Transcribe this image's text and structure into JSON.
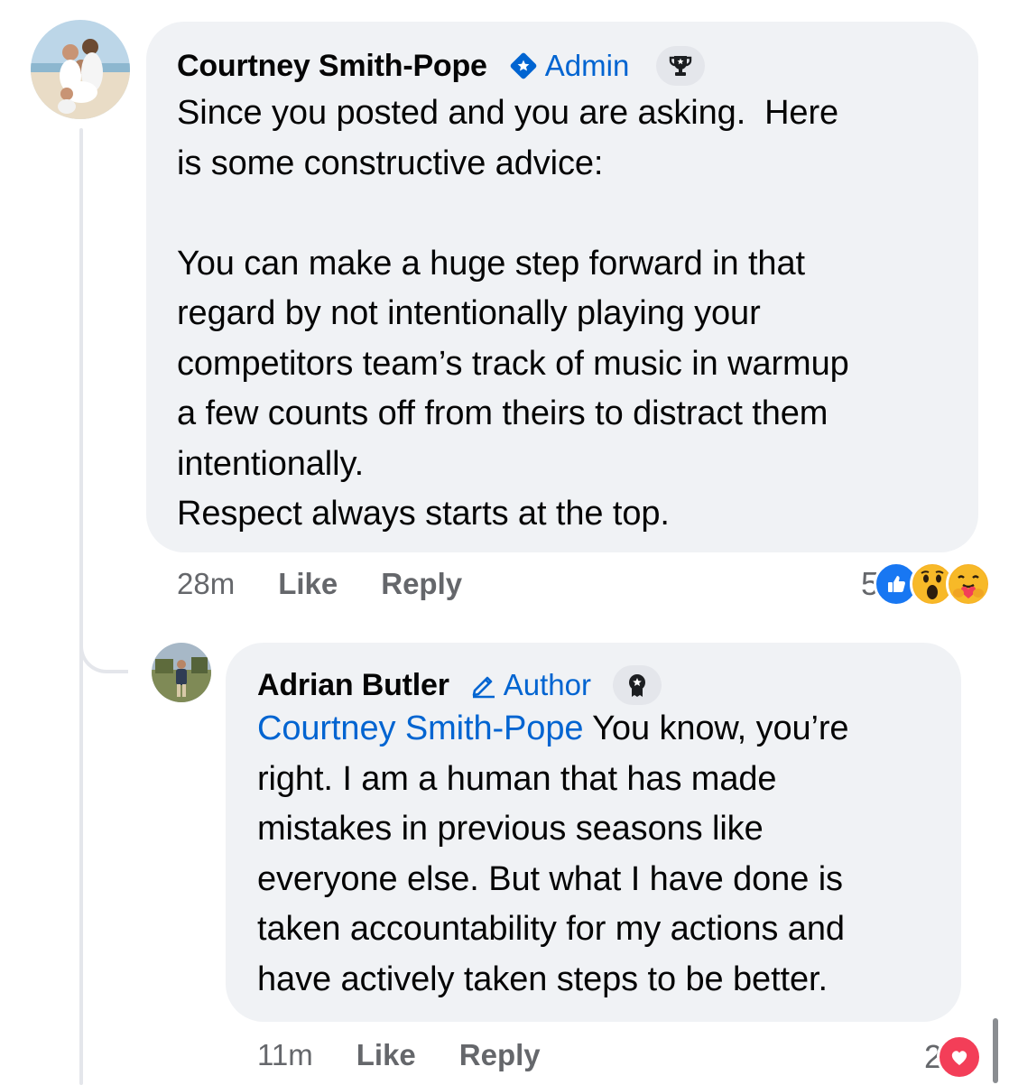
{
  "comments": [
    {
      "author": "Courtney Smith-Pope",
      "role": "Admin",
      "role_icon": "admin-star-diamond-icon",
      "badge_icon": "trophy-icon",
      "text": "Since you posted and you are asking.  Here\nis some constructive advice:\n\nYou can make a huge step forward in that\nregard by not intentionally playing your\ncompetitors team’s track of music in warmup\na few counts off from theirs to distract them\nintentionally.\nRespect always starts at the top.",
      "time": "28m",
      "like_label": "Like",
      "reply_label": "Reply",
      "reaction_count": "5",
      "reactions": [
        "like",
        "wow",
        "care"
      ]
    },
    {
      "author": "Adrian Butler",
      "role": "Author",
      "role_icon": "pencil-icon",
      "badge_icon": "award-ribbon-icon",
      "mention": "Courtney Smith-Pope",
      "text": " You know, you’re\nright. I am a human that has made\nmistakes in previous seasons like\neveryone else. But what I have done is\ntaken accountability for my actions and\nhave actively taken steps to be better.",
      "time": "11m",
      "like_label": "Like",
      "reply_label": "Reply",
      "reaction_count": "2",
      "reactions": [
        "love"
      ]
    }
  ],
  "colors": {
    "bubble": "#f0f2f5",
    "link_blue": "#0064d1",
    "meta_gray": "#65676b",
    "like_blue": "#1877f2",
    "love_red": "#f33e58"
  }
}
